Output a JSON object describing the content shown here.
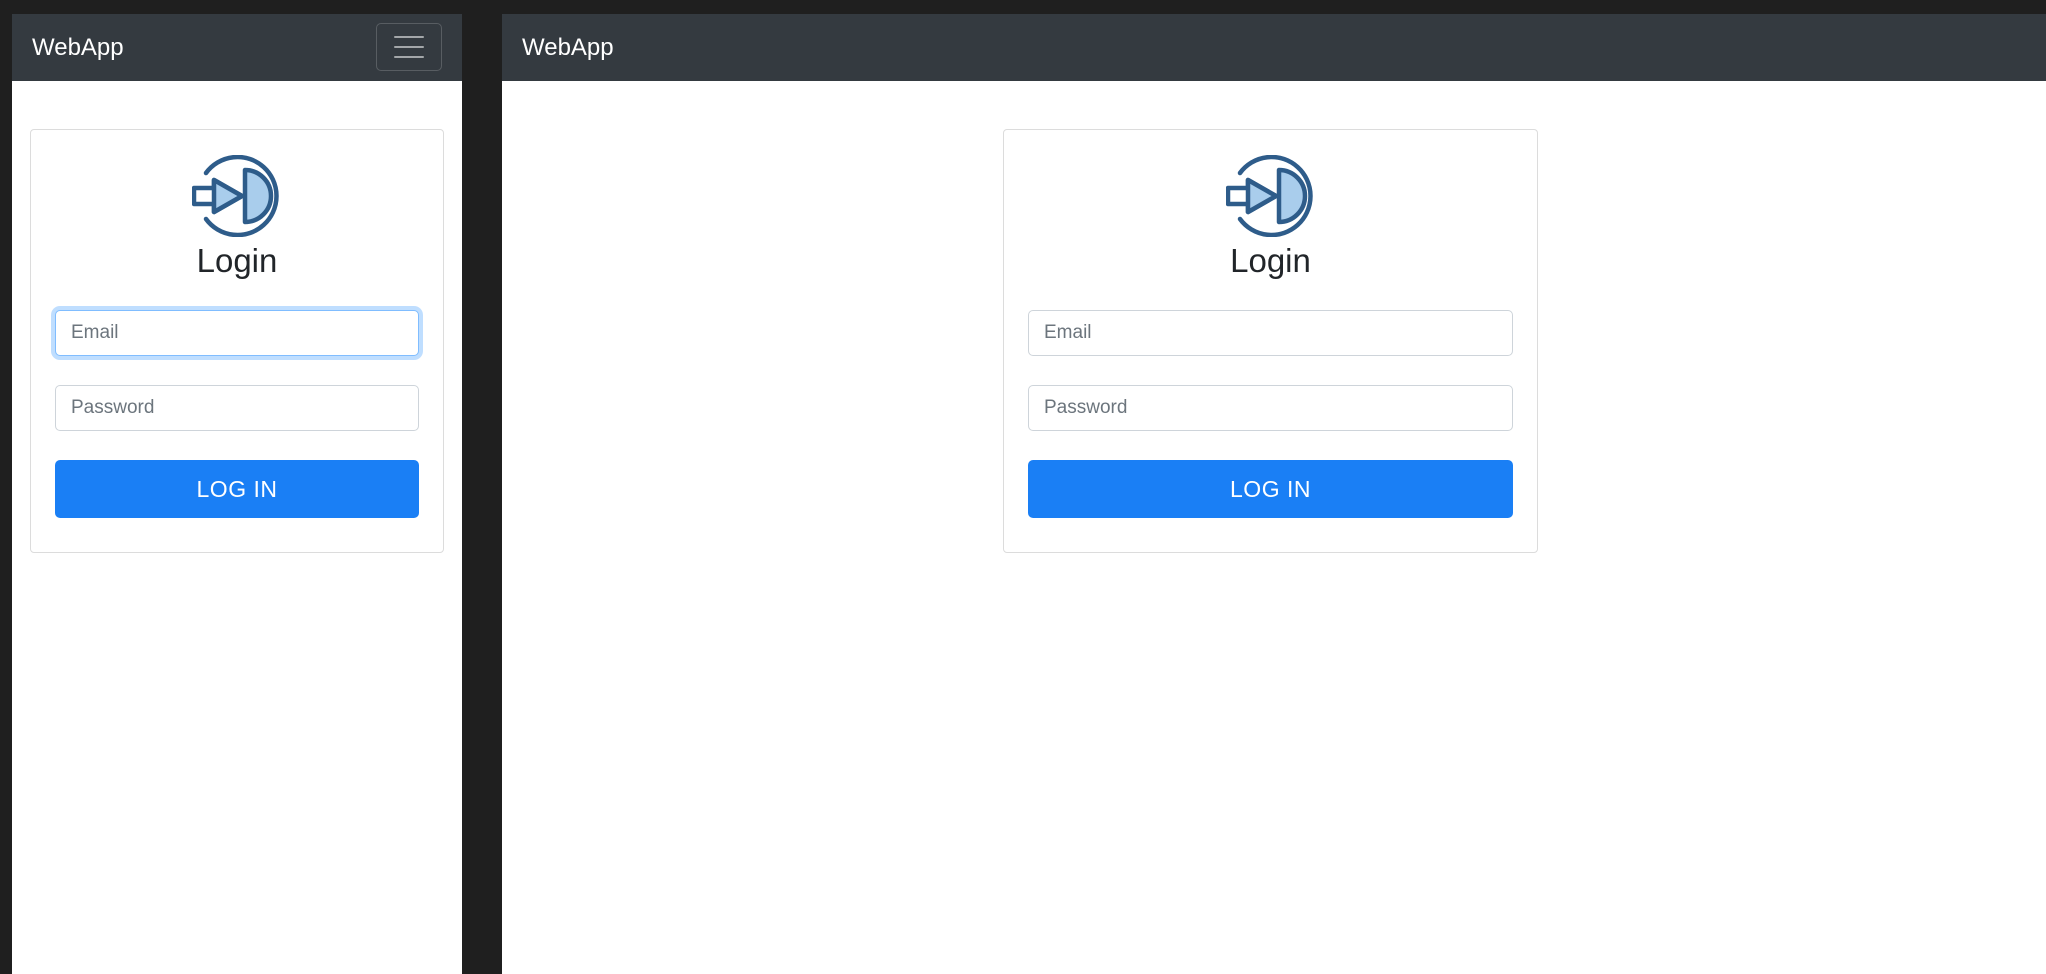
{
  "mobile": {
    "navbar": {
      "brand": "WebApp",
      "toggle_icon": "hamburger-menu-icon"
    },
    "login": {
      "logo_icon": "login-enter-icon",
      "title": "Login",
      "email_placeholder": "Email",
      "email_value": "",
      "email_focused": true,
      "password_placeholder": "Password",
      "password_value": "",
      "submit_label": "LOG IN"
    }
  },
  "desktop": {
    "navbar": {
      "brand": "WebApp"
    },
    "login": {
      "logo_icon": "login-enter-icon",
      "title": "Login",
      "email_placeholder": "Email",
      "email_value": "",
      "password_placeholder": "Password",
      "password_value": "",
      "submit_label": "LOG IN"
    }
  },
  "colors": {
    "navbar_bg": "#343a40",
    "primary": "#1a7ff5",
    "logo_stroke": "#2e5c8a",
    "logo_fill": "#a9cdec",
    "backdrop": "#1f1f1f"
  }
}
